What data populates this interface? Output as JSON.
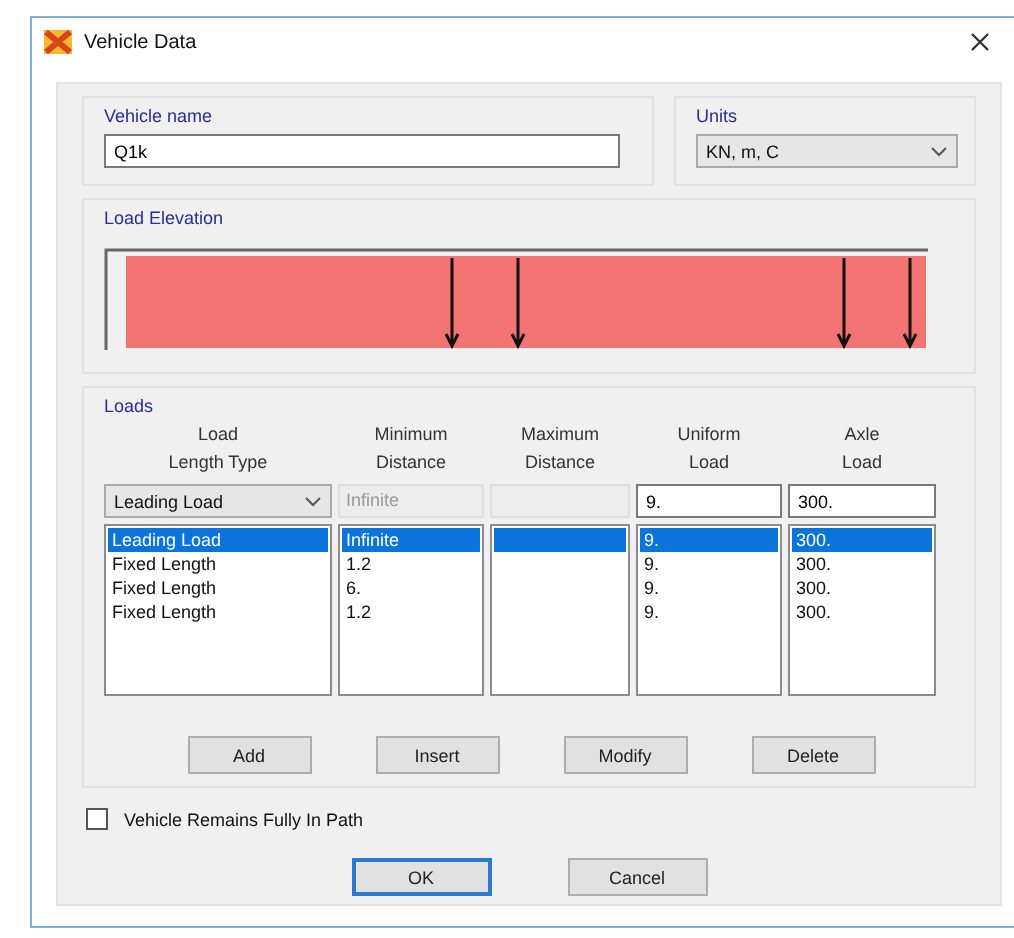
{
  "window": {
    "title": "Vehicle Data"
  },
  "vehicle_name": {
    "label": "Vehicle name",
    "value": "Q1k"
  },
  "units": {
    "label": "Units",
    "value": "KN, m, C"
  },
  "load_elevation": {
    "label": "Load Elevation"
  },
  "loads": {
    "label": "Loads",
    "columns": [
      [
        "Load",
        "Length Type"
      ],
      [
        "Minimum",
        "Distance"
      ],
      [
        "Maximum",
        "Distance"
      ],
      [
        "Uniform",
        "Load"
      ],
      [
        "Axle",
        "Load"
      ]
    ],
    "edit_row": {
      "type": "Leading Load",
      "min": "Infinite",
      "uniform": "9.",
      "axle": "300."
    },
    "rows": [
      {
        "type": "Leading Load",
        "min": "Infinite",
        "uniform": "9.",
        "axle": "300.",
        "selected": true
      },
      {
        "type": "Fixed Length",
        "min": "1.2",
        "uniform": "9.",
        "axle": "300.",
        "selected": false
      },
      {
        "type": "Fixed Length",
        "min": "6.",
        "uniform": "9.",
        "axle": "300.",
        "selected": false
      },
      {
        "type": "Fixed Length",
        "min": "1.2",
        "uniform": "9.",
        "axle": "300.",
        "selected": false
      }
    ],
    "buttons": [
      "Add",
      "Insert",
      "Modify",
      "Delete"
    ]
  },
  "remains_in_path": {
    "label": "Vehicle Remains Fully In Path",
    "checked": false
  },
  "buttons": [
    {
      "label": "OK",
      "default": true
    },
    {
      "label": "Cancel",
      "default": false
    }
  ]
}
